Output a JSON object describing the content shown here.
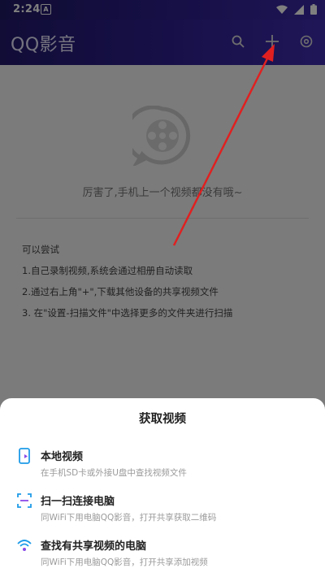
{
  "status_bar": {
    "time": "2:24",
    "app_badge": "A"
  },
  "app_bar": {
    "title": "QQ影音"
  },
  "empty_state": {
    "message": "厉害了,手机上一个视频都没有哦~"
  },
  "tips": {
    "heading": "可以尝试",
    "items": [
      "1.自己录制视频,系统会通过相册自动读取",
      "2.通过右上角\"+\",下载其他设备的共享视频文件",
      "3. 在\"设置-扫描文件\"中选择更多的文件夹进行扫描"
    ]
  },
  "sheet": {
    "title": "获取视频",
    "items": [
      {
        "title": "本地视频",
        "subtitle": "在手机SD卡或外接U盘中查找视频文件"
      },
      {
        "title": "扫一扫连接电脑",
        "subtitle": "同WiFi下用电脑QQ影音，打开共享获取二维码"
      },
      {
        "title": "查找有共享视频的电脑",
        "subtitle": "同WiFi下用电脑QQ影音，打开共享添加视频"
      }
    ]
  },
  "colors": {
    "accent": "#2a1e88",
    "icon_blue": "#1e9be8",
    "icon_purple": "#8a4be8",
    "annotation": "#e02020"
  }
}
